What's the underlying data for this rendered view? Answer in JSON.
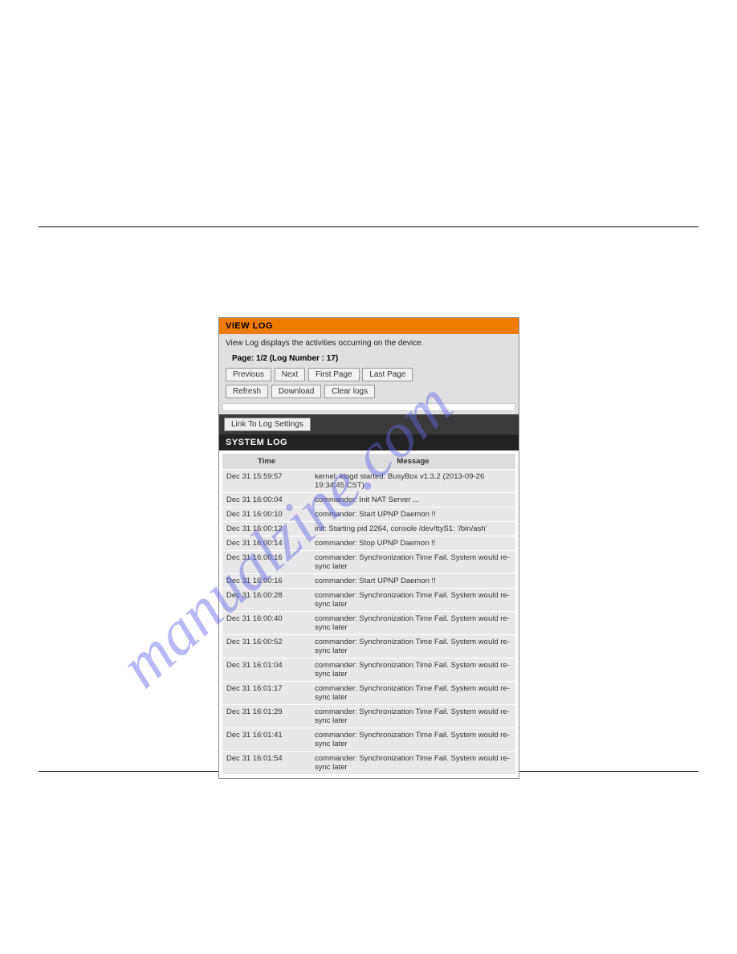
{
  "viewlog": {
    "title": "VIEW LOG",
    "desc": "View Log displays the activities occurring on the device.",
    "page_info": "Page: 1/2 (Log Number : 17)",
    "buttons1": {
      "previous": "Previous",
      "next": "Next",
      "first": "First Page",
      "last": "Last Page"
    },
    "buttons2": {
      "refresh": "Refresh",
      "download": "Download",
      "clear": "Clear logs"
    },
    "link_btn": "Link To Log Settings"
  },
  "syslog": {
    "title": "SYSTEM LOG",
    "col_time": "Time",
    "col_msg": "Message",
    "rows": [
      {
        "time": "Dec 31 15:59:57",
        "msg": "kernel: klogd started: BusyBox v1.3.2 (2013-09-26 19:34:45 CST)"
      },
      {
        "time": "Dec 31 16:00:04",
        "msg": "commander: Init NAT Server ..."
      },
      {
        "time": "Dec 31 16:00:10",
        "msg": "commander: Start UPNP Daemon !!"
      },
      {
        "time": "Dec 31 16:00:12",
        "msg": "init: Starting pid 2264, console /dev/ttyS1: '/bin/ash'"
      },
      {
        "time": "Dec 31 16:00:14",
        "msg": "commander: Stop UPNP Daemon !!"
      },
      {
        "time": "Dec 31 16:00:16",
        "msg": "commander: Synchronization Time Fail. System would re-sync later"
      },
      {
        "time": "Dec 31 16:00:16",
        "msg": "commander: Start UPNP Daemon !!"
      },
      {
        "time": "Dec 31 16:00:28",
        "msg": "commander: Synchronization Time Fail. System would re-sync later"
      },
      {
        "time": "Dec 31 16:00:40",
        "msg": "commander: Synchronization Time Fail. System would re-sync later"
      },
      {
        "time": "Dec 31 16:00:52",
        "msg": "commander: Synchronization Time Fail. System would re-sync later"
      },
      {
        "time": "Dec 31 16:01:04",
        "msg": "commander: Synchronization Time Fail. System would re-sync later"
      },
      {
        "time": "Dec 31 16:01:17",
        "msg": "commander: Synchronization Time Fail. System would re-sync later"
      },
      {
        "time": "Dec 31 16:01:29",
        "msg": "commander: Synchronization Time Fail. System would re-sync later"
      },
      {
        "time": "Dec 31 16:01:41",
        "msg": "commander: Synchronization Time Fail. System would re-sync later"
      },
      {
        "time": "Dec 31 16:01:54",
        "msg": "commander: Synchronization Time Fail. System would re-sync later"
      }
    ]
  },
  "watermark": "manualzine.com"
}
